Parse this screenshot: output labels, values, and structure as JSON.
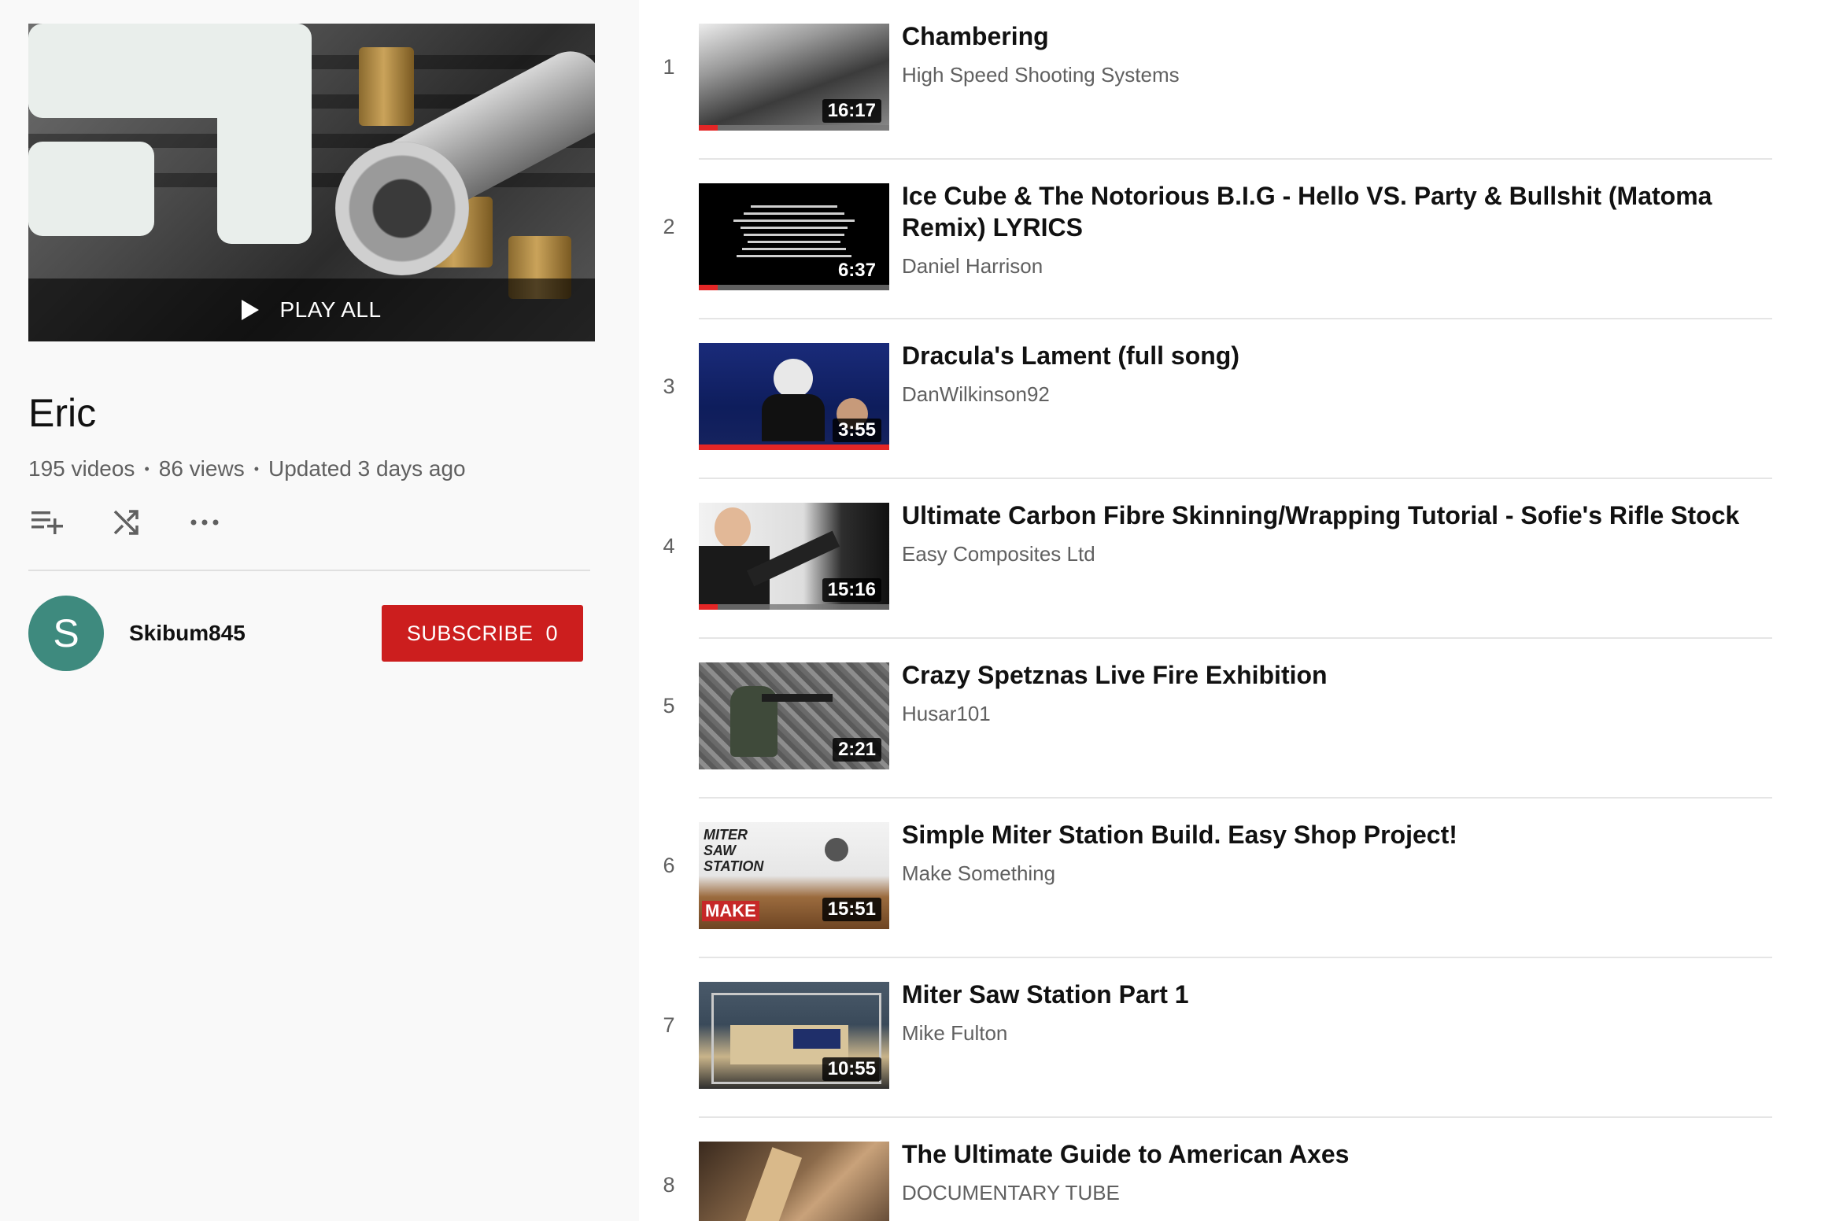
{
  "playlist": {
    "title": "Eric",
    "play_all_label": "PLAY ALL",
    "stats": {
      "videos": "195 videos",
      "views": "86 views",
      "updated": "Updated 3 days ago"
    },
    "actions": [
      "add-to-queue-icon",
      "shuffle-icon",
      "more-icon"
    ],
    "owner": {
      "avatar_letter": "S",
      "avatar_color": "#3e8a7e",
      "name": "Skibum845",
      "subscribe_label": "SUBSCRIBE",
      "subscriber_count": "0"
    }
  },
  "videos": [
    {
      "index": "1",
      "title": "Chambering",
      "channel": "High Speed Shooting Systems",
      "duration": "16:17",
      "watched": 0.1
    },
    {
      "index": "2",
      "title": "Ice Cube & The Notorious B.I.G - Hello VS. Party & Bullshit (Matoma Remix) LYRICS",
      "channel": "Daniel Harrison",
      "duration": "6:37",
      "watched": 0.1
    },
    {
      "index": "3",
      "title": "Dracula's Lament (full song)",
      "channel": "DanWilkinson92",
      "duration": "3:55",
      "watched": 1.0
    },
    {
      "index": "4",
      "title": "Ultimate Carbon Fibre Skinning/Wrapping Tutorial - Sofie's Rifle Stock",
      "channel": "Easy Composites Ltd",
      "duration": "15:16",
      "watched": 0.1
    },
    {
      "index": "5",
      "title": "Crazy Spetznas Live Fire Exhibition",
      "channel": "Husar101",
      "duration": "2:21",
      "watched": 0
    },
    {
      "index": "6",
      "title": "Simple Miter Station Build. Easy Shop Project!",
      "channel": "Make Something",
      "duration": "15:51",
      "watched": 0
    },
    {
      "index": "7",
      "title": "Miter Saw Station Part 1",
      "channel": "Mike Fulton",
      "duration": "10:55",
      "watched": 0
    },
    {
      "index": "8",
      "title": "The Ultimate Guide to American Axes",
      "channel": "DOCUMENTARY TUBE",
      "duration": "",
      "watched": 0
    }
  ],
  "thumb_text": {
    "miter_label": "MITER SAW STATION",
    "make_logo": "MAKE"
  },
  "colors": {
    "subscribe_red": "#cc1e1e",
    "progress_red": "#e32626"
  }
}
